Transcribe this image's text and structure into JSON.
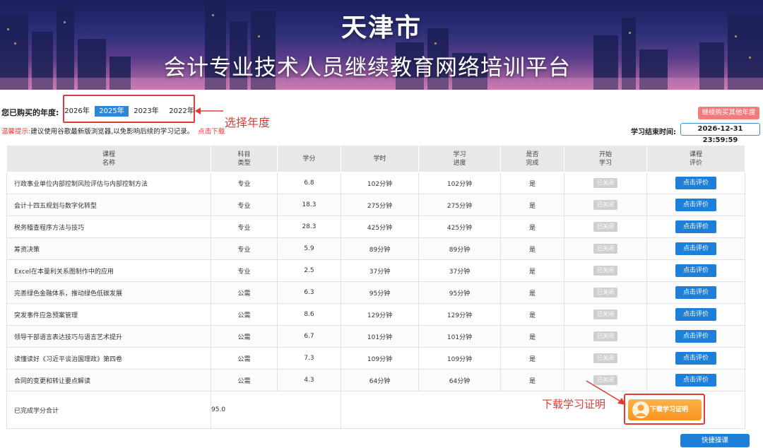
{
  "banner": {
    "city": "天津市",
    "title": "会计专业技术人员继续教育网络培训平台"
  },
  "years": {
    "label": "您已购买的年度:",
    "items": [
      {
        "label": "2026年",
        "active": false
      },
      {
        "label": "2025年",
        "active": true
      },
      {
        "label": "2023年",
        "active": false
      },
      {
        "label": "2022年",
        "active": false
      }
    ]
  },
  "annotations": {
    "select_year": "选择年度",
    "download_cert": "下载学习证明"
  },
  "notice": {
    "warn": "温馨提示:",
    "text": "建议使用谷歌最新版浏览器,以免影响后续的学习记录。",
    "download": "点击下载"
  },
  "buy_button": "继续购买其他年度",
  "end_time": {
    "label": "学习结束时间:",
    "value": "2026-12-31 23:59:59"
  },
  "table": {
    "headers": [
      [
        "课程",
        "名称"
      ],
      [
        "科目",
        "类型"
      ],
      [
        "学分",
        ""
      ],
      [
        "学时",
        ""
      ],
      [
        "学习",
        "进度"
      ],
      [
        "是否",
        "完成"
      ],
      [
        "开始",
        "学习"
      ],
      [
        "课程",
        "评价"
      ]
    ],
    "rows": [
      {
        "name": "行政事业单位内部控制风险评估与内部控制方法",
        "type": "专业",
        "credit": "6.8",
        "hours": "102分钟",
        "progress": "102分钟",
        "done": "是",
        "status": "已关闭",
        "eval": "点击评价"
      },
      {
        "name": "会计十四五规划与数字化转型",
        "type": "专业",
        "credit": "18.3",
        "hours": "275分钟",
        "progress": "275分钟",
        "done": "是",
        "status": "已关闭",
        "eval": "点击评价"
      },
      {
        "name": "税务稽查程序方法与技巧",
        "type": "专业",
        "credit": "28.3",
        "hours": "425分钟",
        "progress": "425分钟",
        "done": "是",
        "status": "已关闭",
        "eval": "点击评价"
      },
      {
        "name": "筹资决策",
        "type": "专业",
        "credit": "5.9",
        "hours": "89分钟",
        "progress": "89分钟",
        "done": "是",
        "status": "已关闭",
        "eval": "点击评价"
      },
      {
        "name": "Excel在本量利关系图制作中的应用",
        "type": "专业",
        "credit": "2.5",
        "hours": "37分钟",
        "progress": "37分钟",
        "done": "是",
        "status": "已关闭",
        "eval": "点击评价"
      },
      {
        "name": "完善绿色金融体系，推动绿色低碳发展",
        "type": "公需",
        "credit": "6.3",
        "hours": "95分钟",
        "progress": "95分钟",
        "done": "是",
        "status": "已关闭",
        "eval": "点击评价"
      },
      {
        "name": "突发事件应急预案管理",
        "type": "公需",
        "credit": "8.6",
        "hours": "129分钟",
        "progress": "129分钟",
        "done": "是",
        "status": "已关闭",
        "eval": "点击评价"
      },
      {
        "name": "领导干部语言表达技巧与语言艺术提升",
        "type": "公需",
        "credit": "6.7",
        "hours": "101分钟",
        "progress": "101分钟",
        "done": "是",
        "status": "已关闭",
        "eval": "点击评价"
      },
      {
        "name": "读懂读好《习近平谈治国理政》第四卷",
        "type": "公需",
        "credit": "7.3",
        "hours": "109分钟",
        "progress": "109分钟",
        "done": "是",
        "status": "已关闭",
        "eval": "点击评价"
      },
      {
        "name": "合同的变更和转让要点解读",
        "type": "公需",
        "credit": "4.3",
        "hours": "64分钟",
        "progress": "64分钟",
        "done": "是",
        "status": "已关闭",
        "eval": "点击评价"
      }
    ],
    "summary": {
      "label": "已完成学分合计",
      "value": "95.0"
    }
  },
  "cert_button": "下载学习证明",
  "quick_button": "快捷操课",
  "colors": {
    "accent": "#1e7fd9",
    "annotation": "#e53935",
    "cert": "#f7931e"
  }
}
